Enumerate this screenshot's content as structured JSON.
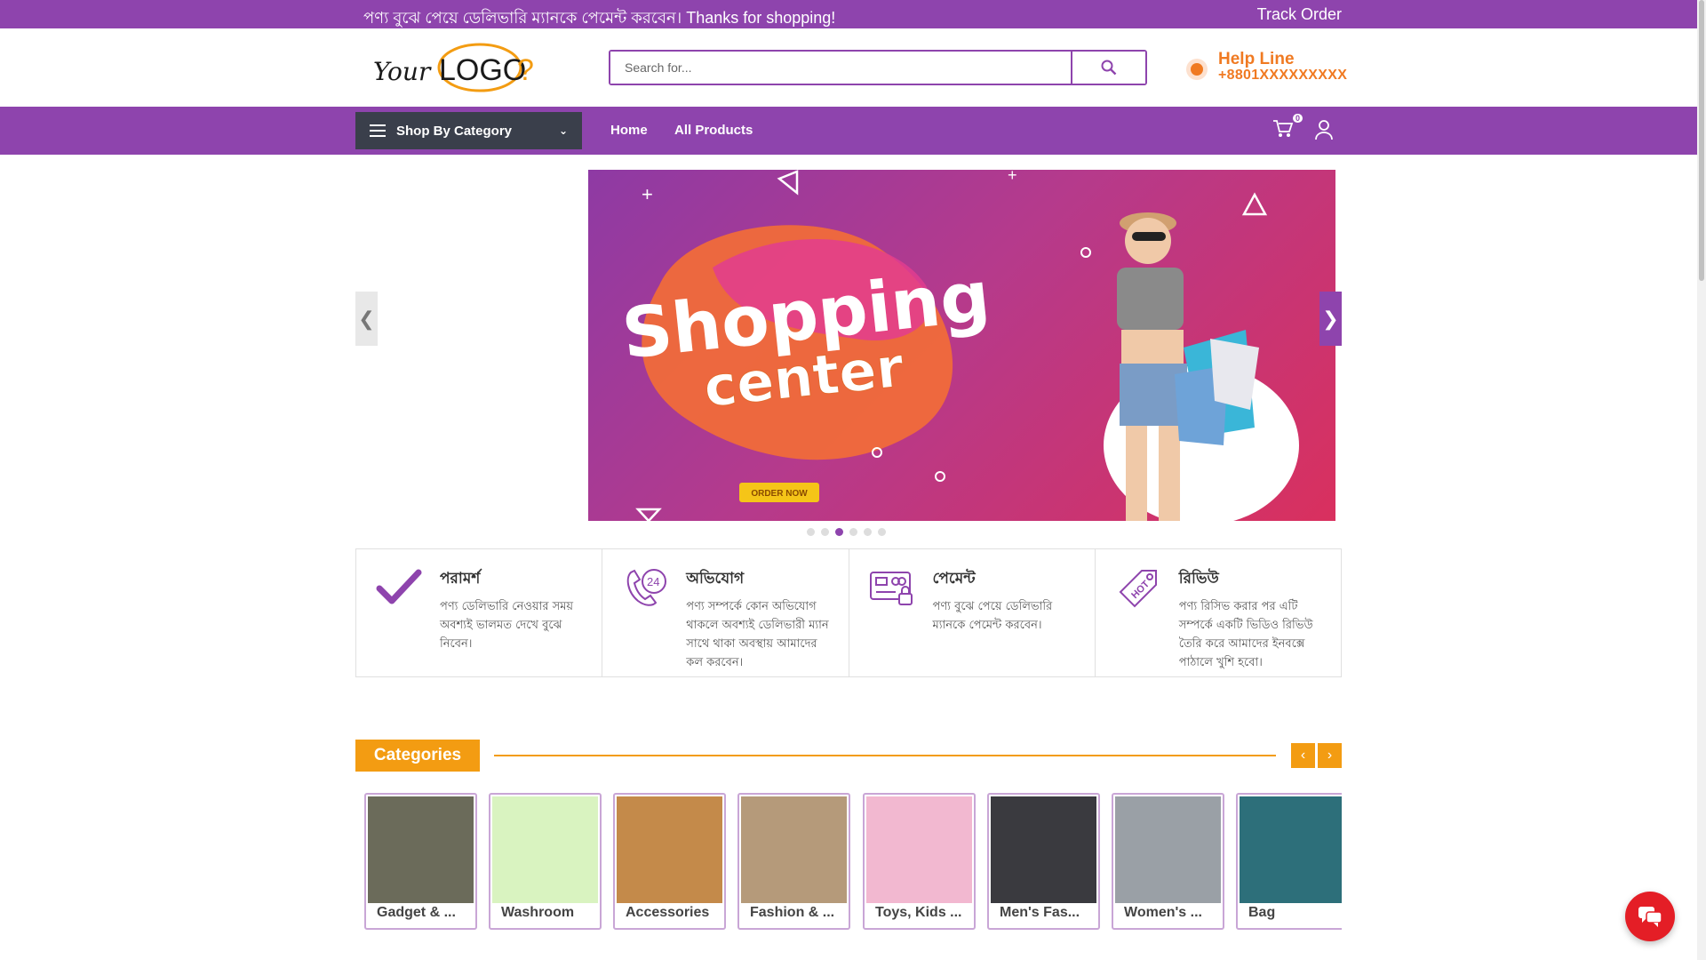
{
  "topbar": {
    "message": "পণ্য বুঝে পেয়ে ডেলিভারি ম্যানকে পেমেন্ট করবেন। Thanks for shopping!",
    "track_order": "Track Order"
  },
  "header": {
    "logo_text": "YourLOGO?",
    "search": {
      "placeholder": "Search for...",
      "icon": "search-icon"
    },
    "helpline": {
      "title": "Help Line",
      "phone": "+8801XXXXXXXXX",
      "icon": "phone-icon"
    }
  },
  "nav": {
    "category_button": "Shop By Category",
    "links": [
      "Home",
      "All Products"
    ],
    "cart_count": "0",
    "icons": [
      "cart-icon",
      "user-icon"
    ]
  },
  "slider": {
    "banner_title": "Shopping",
    "banner_subtitle": "center",
    "cta": "ORDER NOW",
    "prev": "❮",
    "next": "❯",
    "dot_count": 6,
    "active_dot": 3
  },
  "features": [
    {
      "title": "পরামর্শ",
      "text": "পণ্য ডেলিভারি নেওয়ার সময় অবশ্যই ভালমত দেখে বুঝে নিবেন।",
      "icon": "check-icon"
    },
    {
      "title": "অভিযোগ",
      "text": "পণ্য সম্পর্কে কোন অভিযোগ থাকলে অবশ্যই ডেলিভারী ম্যান সাথে থাকা অবস্থায় আমাদের কল করবেন।",
      "icon": "support-24-icon"
    },
    {
      "title": "পেমেন্ট",
      "text": "পণ্য বুঝে পেয়ে ডেলিভারি ম্যানকে পেমেন্ট করবেন।",
      "icon": "payment-card-icon"
    },
    {
      "title": "রিভিউ",
      "text": "পণ্য রিসিভ করার পর এটি সম্পর্কে একটি ভিডিও রিভিউ তৈরি করে আমাদের ইনবক্সে পাঠালে খুশি হবো।",
      "icon": "hot-tag-icon"
    }
  ],
  "categories": {
    "heading": "Categories",
    "prev": "‹",
    "next": "›",
    "items": [
      {
        "name": "Gadget & ...",
        "color": "#6b6b5a"
      },
      {
        "name": "Washroom",
        "color": "#d9f3c0"
      },
      {
        "name": "Accessories",
        "color": "#c48a4a"
      },
      {
        "name": "Fashion & ...",
        "color": "#b59a7a"
      },
      {
        "name": "Toys, Kids ...",
        "color": "#f2b8d0"
      },
      {
        "name": "Men's Fas...",
        "color": "#3a3a3f"
      },
      {
        "name": "Women's ...",
        "color": "#9aa0a6"
      },
      {
        "name": "Bag",
        "color": "#2d6f7a"
      }
    ]
  },
  "colors": {
    "primary": "#8e44ad",
    "accent": "#f39c12",
    "helpline": "#f07a22",
    "chat": "#e41e26"
  }
}
